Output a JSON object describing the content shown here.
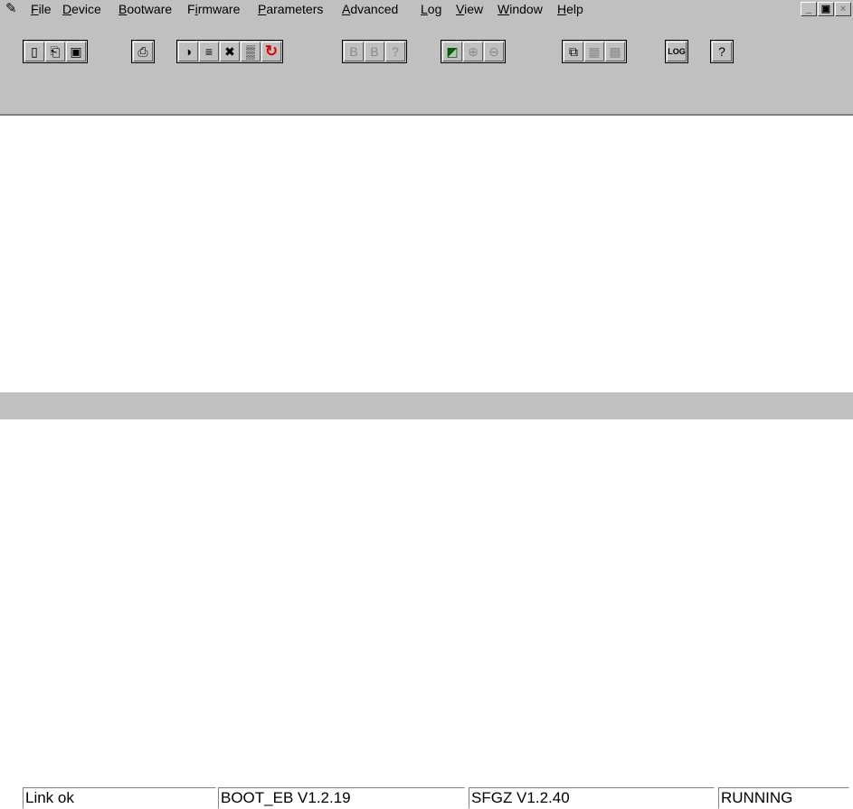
{
  "menubar": {
    "app_icon": "notepad-icon",
    "items": [
      {
        "label": "File",
        "underline": "F"
      },
      {
        "label": "Device",
        "underline": "D"
      },
      {
        "label": "Bootware",
        "underline": "B"
      },
      {
        "label": "Firmware",
        "underline": "i"
      },
      {
        "label": "Parameters",
        "underline": "P"
      },
      {
        "label": "Advanced",
        "underline": "A"
      },
      {
        "label": "Log",
        "underline": "L"
      },
      {
        "label": "View",
        "underline": "V"
      },
      {
        "label": "Window",
        "underline": "W"
      },
      {
        "label": "Help",
        "underline": "H"
      }
    ],
    "mdi": {
      "minimize": "_",
      "restore": "▣",
      "close": "×"
    }
  },
  "toolbar": {
    "groups": [
      {
        "buttons": [
          {
            "icon": "new-file-icon",
            "glyph": "▯"
          },
          {
            "icon": "open-folder-icon",
            "glyph": "⎗"
          },
          {
            "icon": "save-icon",
            "glyph": "▣"
          }
        ]
      },
      {
        "buttons": [
          {
            "icon": "print-icon",
            "glyph": "⎙"
          }
        ]
      },
      {
        "buttons": [
          {
            "icon": "connect-icon",
            "glyph": "◑"
          },
          {
            "icon": "traffic-light-icon",
            "glyph": "≡"
          },
          {
            "icon": "disconnect-icon",
            "glyph": "✖"
          },
          {
            "icon": "grid-io-icon",
            "glyph": "▒"
          },
          {
            "icon": "reset-icon",
            "glyph": "↻",
            "style": "red"
          }
        ]
      },
      {
        "buttons": [
          {
            "icon": "upload-icon",
            "glyph": "B",
            "style": "dis"
          },
          {
            "icon": "download-icon",
            "glyph": "B",
            "style": "dis"
          },
          {
            "icon": "query-icon",
            "glyph": "?",
            "style": "dis"
          }
        ]
      },
      {
        "buttons": [
          {
            "icon": "chart-icon",
            "glyph": "◩",
            "style": "grn"
          },
          {
            "icon": "zoom-in-icon",
            "glyph": "⊕",
            "style": "dis"
          },
          {
            "icon": "zoom-out-icon",
            "glyph": "⊖",
            "style": "dis"
          }
        ]
      },
      {
        "buttons": [
          {
            "icon": "copy-window-icon",
            "glyph": "⧉"
          },
          {
            "icon": "panel-icon",
            "glyph": "▦",
            "style": "dis"
          },
          {
            "icon": "table-icon",
            "glyph": "▩",
            "style": "dis"
          }
        ]
      },
      {
        "buttons": [
          {
            "icon": "log-icon",
            "glyph": "LOG",
            "style": "log"
          }
        ]
      },
      {
        "buttons": [
          {
            "icon": "help-icon",
            "glyph": "?"
          }
        ]
      }
    ]
  },
  "address": {
    "value": ""
  },
  "statusbar": {
    "link": "Link ok",
    "boot": "BOOT_EB V1.2.19",
    "firmware": "SFGZ V1.2.40",
    "state": "RUNNING"
  }
}
